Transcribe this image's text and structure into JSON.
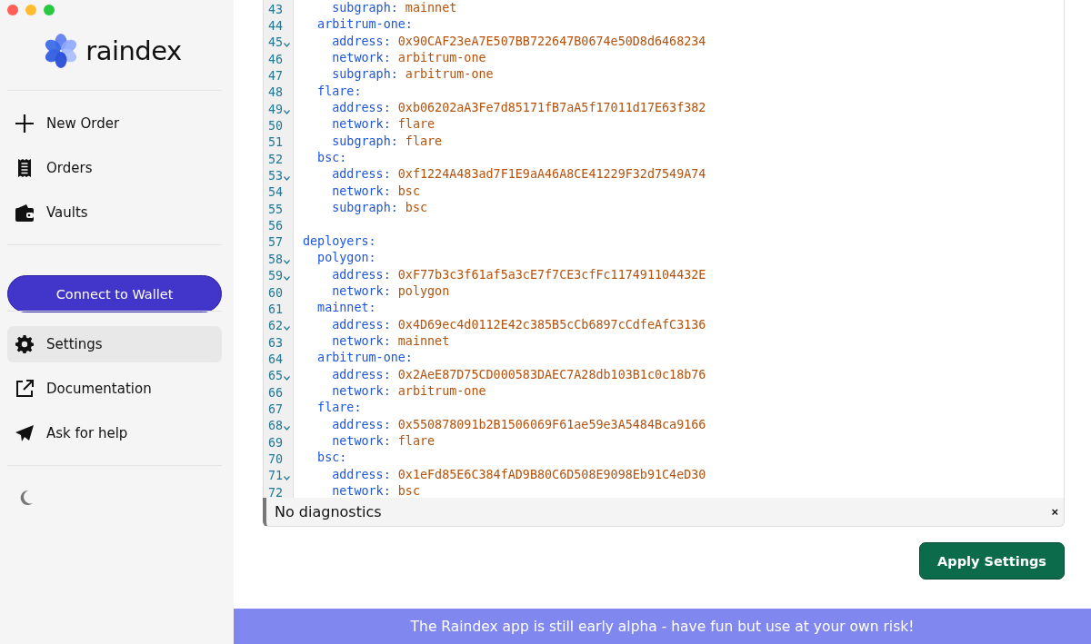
{
  "sidebar": {
    "logo": "raindex",
    "nav": [
      {
        "label": "New Order",
        "selected": false
      },
      {
        "label": "Orders",
        "selected": false
      },
      {
        "label": "Vaults",
        "selected": false
      }
    ],
    "connect_button": "Connect to Wallet",
    "secondary_nav": [
      {
        "label": "Settings",
        "selected": true
      },
      {
        "label": "Documentation",
        "selected": false
      },
      {
        "label": "Ask for help",
        "selected": false
      }
    ],
    "theme_toggle": {
      "dark": false
    }
  },
  "editor": {
    "lines": [
      {
        "number": "43",
        "key": "    subgraph:",
        "value": "mainnet",
        "foldable": false
      },
      {
        "number": "44",
        "key": "  arbitrum-one:",
        "foldable": false
      },
      {
        "number": "45",
        "key": "    address:",
        "value": "0x90CAF23eA7E507BB722647B0674e50D8d6468234",
        "foldable": true
      },
      {
        "number": "46",
        "key": "    network:",
        "value": "arbitrum-one",
        "foldable": false
      },
      {
        "number": "47",
        "key": "    subgraph:",
        "value": "arbitrum-one",
        "foldable": false
      },
      {
        "number": "48",
        "key": "  flare:",
        "foldable": false
      },
      {
        "number": "49",
        "key": "    address:",
        "value": "0xb06202aA3Fe7d85171fB7aA5f17011d17E63f382",
        "foldable": true
      },
      {
        "number": "50",
        "key": "    network:",
        "value": "flare",
        "foldable": false
      },
      {
        "number": "51",
        "key": "    subgraph:",
        "value": "flare",
        "foldable": false
      },
      {
        "number": "52",
        "key": "  bsc:",
        "foldable": false
      },
      {
        "number": "53",
        "key": "    address:",
        "value": "0xf1224A483ad7F1E9aA46A8CE41229F32d7549A74",
        "foldable": true
      },
      {
        "number": "54",
        "key": "    network:",
        "value": "bsc",
        "foldable": false
      },
      {
        "number": "55",
        "key": "    subgraph:",
        "value": "bsc",
        "foldable": false
      },
      {
        "number": "56",
        "foldable": false
      },
      {
        "number": "57",
        "key": "deployers:",
        "foldable": false
      },
      {
        "number": "58",
        "key": "  polygon:",
        "foldable": true
      },
      {
        "number": "59",
        "key": "    address:",
        "value": "0xF77b3c3f61af5a3cE7f7CE3cfFc117491104432E",
        "foldable": true
      },
      {
        "number": "60",
        "key": "    network:",
        "value": "polygon",
        "foldable": false
      },
      {
        "number": "61",
        "key": "  mainnet:",
        "foldable": false
      },
      {
        "number": "62",
        "key": "    address:",
        "value": "0x4D69ec4d0112E42c385B5cCb6897cCdfeAfC3136",
        "foldable": true
      },
      {
        "number": "63",
        "key": "    network:",
        "value": "mainnet",
        "foldable": false
      },
      {
        "number": "64",
        "key": "  arbitrum-one:",
        "foldable": false
      },
      {
        "number": "65",
        "key": "    address:",
        "value": "0x2AeE87D75CD000583DAEC7A28db103B1c0c18b76",
        "foldable": true
      },
      {
        "number": "66",
        "key": "    network:",
        "value": "arbitrum-one",
        "foldable": false
      },
      {
        "number": "67",
        "key": "  flare:",
        "foldable": false
      },
      {
        "number": "68",
        "key": "    address:",
        "value": "0x550878091b2B1506069F61ae59e3A5484Bca9166",
        "foldable": true
      },
      {
        "number": "69",
        "key": "    network:",
        "value": "flare",
        "foldable": false
      },
      {
        "number": "70",
        "key": "  bsc:",
        "foldable": false
      },
      {
        "number": "71",
        "key": "    address:",
        "value": "0x1eFd85E6C384fAD9B80C6D508E9098Eb91C4eD30",
        "foldable": true
      },
      {
        "number": "72",
        "key": "    network:",
        "value": "bsc",
        "foldable": false
      }
    ],
    "diagnostics": "No diagnostics",
    "close_label": "×"
  },
  "apply_button": "Apply Settings",
  "banner": "The Raindex app is still early alpha - have fun but use at your own risk!"
}
